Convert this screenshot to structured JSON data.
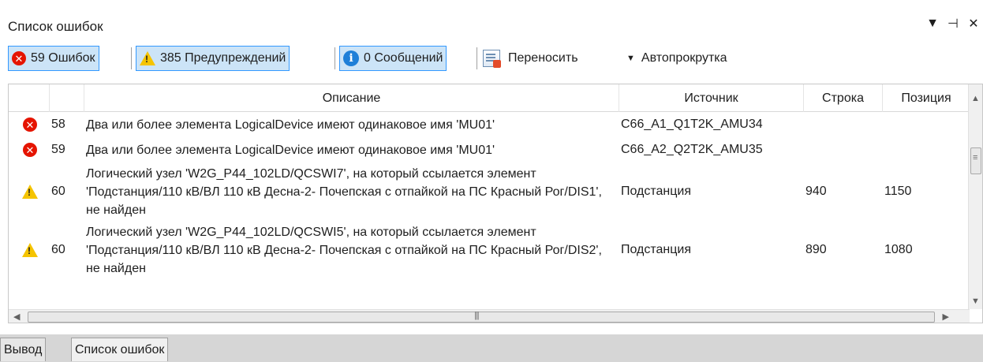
{
  "panel": {
    "title": "Список ошибок",
    "controls": {
      "dropdown": "▼",
      "pin": "⊣",
      "close": "✕"
    }
  },
  "toolbar": {
    "errors_label": "59 Ошибок",
    "warnings_label": "385 Предупреждений",
    "messages_label": "0 Сообщений",
    "wrap_label": "Переносить",
    "autoscroll_label": "Автопрокрутка"
  },
  "columns": {
    "description": "Описание",
    "source": "Источник",
    "line": "Строка",
    "position": "Позиция"
  },
  "rows": [
    {
      "kind": "error",
      "num": "58",
      "description": "Два или более элемента LogicalDevice имеют одинаковое имя 'MU01'",
      "source": "C66_A1_Q1T2K_AMU34",
      "line": "",
      "position": ""
    },
    {
      "kind": "error",
      "num": "59",
      "description": "Два или более элемента LogicalDevice имеют одинаковое имя 'MU01'",
      "source": "C66_A2_Q2T2K_AMU35",
      "line": "",
      "position": ""
    },
    {
      "kind": "warning",
      "num": "60",
      "description": "Логический узел 'W2G_P44_102LD/QCSWI7', на который ссылается элемент 'Подстанция/110 кВ/ВЛ 110 кВ Десна-2- Почепская с отпайкой на ПС Красный Рог/DIS1', не найден",
      "source": "Подстанция",
      "line": "940",
      "position": "1150"
    },
    {
      "kind": "warning",
      "num": "60",
      "description": "Логический узел 'W2G_P44_102LD/QCSWI5', на который ссылается элемент 'Подстанция/110 кВ/ВЛ 110 кВ Десна-2- Почепская с отпайкой на ПС Красный Рог/DIS2', не найден",
      "source": "Подстанция",
      "line": "890",
      "position": "1080"
    }
  ],
  "bottom_tabs": [
    "Вывод",
    "Список ошибок"
  ]
}
